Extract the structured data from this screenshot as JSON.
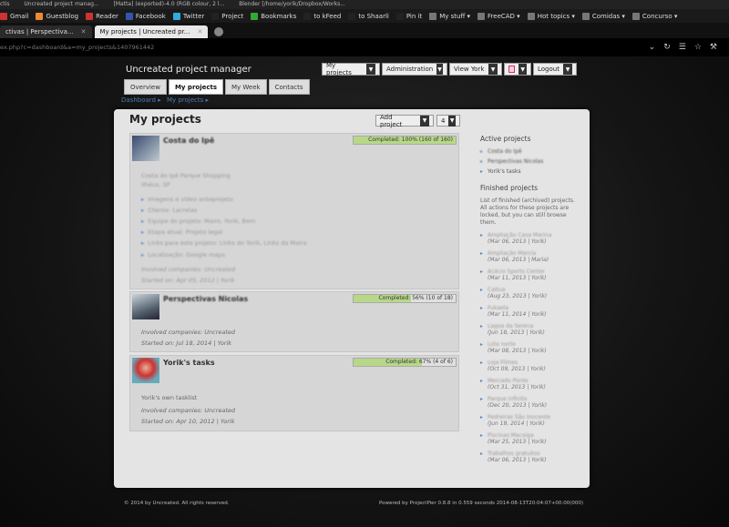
{
  "os_bar": [
    "ctis",
    "Uncreated project manag...",
    "[Matta] (exported)-4.0 (RGB colour, 2 l...",
    "Blender [/home/yorik/Dropbox/Works..."
  ],
  "bookmarks": [
    {
      "label": "Gmail",
      "color": "#c33"
    },
    {
      "label": "Guestblog",
      "color": "#e83"
    },
    {
      "label": "Reader",
      "color": "#c33"
    },
    {
      "label": "Facebook",
      "color": "#35a"
    },
    {
      "label": "Twitter",
      "color": "#3ad"
    },
    {
      "label": "Project",
      "color": "#222"
    },
    {
      "label": "Bookmarks",
      "color": "#3a3"
    },
    {
      "label": "to kFeed",
      "color": "#222"
    },
    {
      "label": "to Shaarli",
      "color": "#222"
    },
    {
      "label": "Pin it",
      "color": "#222"
    },
    {
      "label": "My stuff ▾",
      "color": "#777"
    },
    {
      "label": "FreeCAD ▾",
      "color": "#777"
    },
    {
      "label": "Hot topics ▾",
      "color": "#777"
    },
    {
      "label": "Comidas ▾",
      "color": "#777"
    },
    {
      "label": "Concurso ▾",
      "color": "#777"
    }
  ],
  "browser_tabs": [
    {
      "label": "ctivas | Perspectiva..."
    },
    {
      "label": "My projects | Uncreated pr..."
    }
  ],
  "url": "ex.php?c=dashboard&a=my_projects&1407961442",
  "app_title": "Uncreated project manager",
  "topnav": {
    "my_projects": "My projects",
    "administration": "Administration",
    "user": "View York",
    "logout": "Logout"
  },
  "tabs": {
    "overview": "Overview",
    "my_projects": "My projects",
    "my_week": "My Week",
    "contacts": "Contacts"
  },
  "breadcrumb": {
    "dashboard": "Dashboard ▸",
    "my_projects": "My projects ▸"
  },
  "page_title": "My projects",
  "add_project": "Add project",
  "count_select": "4",
  "projects": [
    {
      "name": "Costa do Ipê",
      "progress_text": "Completed: 100% (160 of 160)",
      "progress_pct": 100,
      "desc1": "Costa do Ipê Parque Shopping",
      "desc2": "Ilhéus, SP",
      "items": [
        "Imagens e vídeo anteprojeto",
        "Cliente: Lacrelas",
        "Equipe do projeto: Mairo, Yorik, Bem",
        "Etapa atual: Projeto legal",
        "Links para este projeto: Links do Yorik, Links da Maira",
        "Localização: Google maps"
      ],
      "companies": "Involved companies: Uncreated",
      "started": "Started on: Apr 05, 2012 | Yorik"
    },
    {
      "name": "Perspectivas Nicolas",
      "progress_text": "Completed: 56% (10 of 18)",
      "progress_pct": 56,
      "companies": "Involved companies: Uncreated",
      "started": "Started on: Jul 18, 2014 | Yorik"
    },
    {
      "name": "Yorik's tasks",
      "progress_text": "Completed: 67% (4 of 6)",
      "progress_pct": 67,
      "desc1": "Yorik's own tasklist",
      "companies": "Involved companies: Uncreated",
      "started": "Started on: Apr 10, 2012 | Yorik"
    }
  ],
  "sidebar": {
    "active_title": "Active projects",
    "active": [
      "Costa do Ipê",
      "Perspectivas Nicolas",
      "Yorik's tasks"
    ],
    "finished_title": "Finished projects",
    "finished_desc": "List of finished (archived) projects. All actions for these projects are locked, but you can still browse them.",
    "finished": [
      {
        "name": "Ampliação Casa Marina",
        "date": "(Mar 06, 2013 | Yorik)"
      },
      {
        "name": "Ampliação Marcia",
        "date": "(Mar 06, 2013 | Maria)"
      },
      {
        "name": "Acácio Sports Center",
        "date": "(Mar 11, 2013 | Yorik)"
      },
      {
        "name": "Caitua",
        "date": "(Aug 23, 2013 | Yorik)"
      },
      {
        "name": "Fukaela",
        "date": "(Mar 11, 2014 | Yorik)"
      },
      {
        "name": "Lagoa da Serena",
        "date": "(Jun 18, 2013 | Yorik)"
      },
      {
        "name": "Lote norte",
        "date": "(Mar 08, 2013 | Yorik)"
      },
      {
        "name": "Loja Filmes",
        "date": "(Oct 09, 2013 | Yorik)"
      },
      {
        "name": "Mercado Ponte",
        "date": "(Oct 31, 2013 | Yorik)"
      },
      {
        "name": "Parque infinito",
        "date": "(Dec 20, 2013 | Yorik)"
      },
      {
        "name": "Pedreiras São Inocente",
        "date": "(Jun 19, 2014 | Yorik)"
      },
      {
        "name": "Piscinas Macaiga",
        "date": "(Mar 25, 2013 | Yorik)"
      },
      {
        "name": "Trabalhos gratuitos",
        "date": "(Mar 06, 2013 | Yorik)"
      }
    ]
  },
  "footer_left": "© 2014 by Uncreated. All rights reserved.",
  "footer_right": "Powered by ProjectPier 0.8.8 in 0.559 seconds 2014-08-13T20:04:07+00:00(000)"
}
